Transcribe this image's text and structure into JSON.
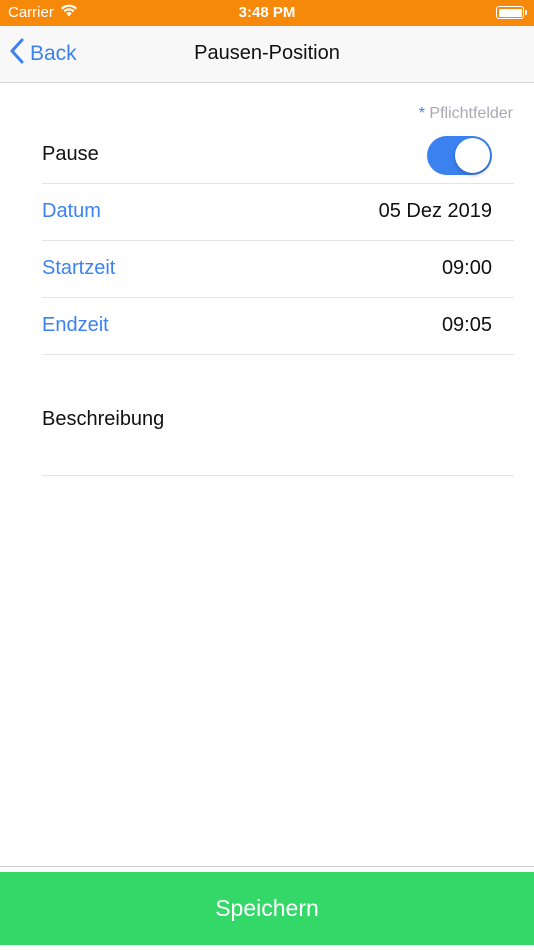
{
  "status_bar": {
    "carrier": "Carrier",
    "time": "3:48 PM",
    "wifi_icon": "wifi-icon",
    "battery_icon": "battery-icon"
  },
  "nav": {
    "back_label": "Back",
    "back_icon": "chevron-left-icon",
    "title": "Pausen-Position"
  },
  "form": {
    "required_star": "*",
    "required_note": "Pflichtfelder",
    "pause": {
      "label": "Pause",
      "toggle_on": true
    },
    "datum": {
      "label": "Datum",
      "value": "05 Dez 2019"
    },
    "startzeit": {
      "label": "Startzeit",
      "value": "09:00"
    },
    "endzeit": {
      "label": "Endzeit",
      "value": "09:05"
    },
    "beschreibung": {
      "label": "Beschreibung"
    }
  },
  "footer": {
    "save_label": "Speichern"
  },
  "colors": {
    "status_bar": "#f7890a",
    "accent": "#3b82f0",
    "save_button": "#34d868"
  }
}
